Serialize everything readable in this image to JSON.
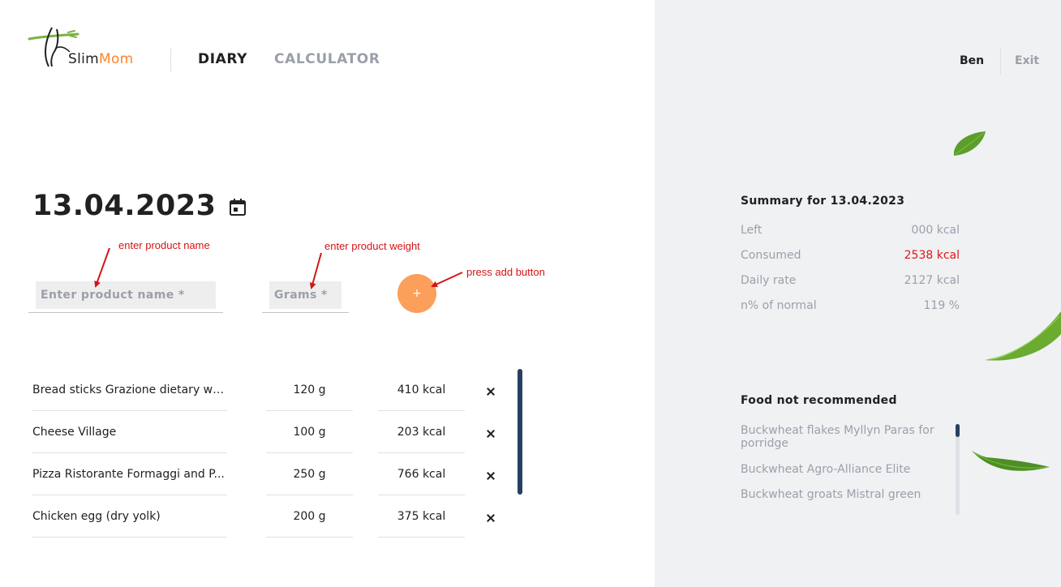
{
  "header": {
    "logo": {
      "slim": "Slim",
      "mom": "Mom"
    },
    "nav": {
      "diary": "DIARY",
      "calculator": "CALCULATOR"
    },
    "user": {
      "name": "Ben",
      "exit": "Exit"
    }
  },
  "diary": {
    "date": "13.04.2023",
    "product_placeholder": "Enter product name *",
    "grams_placeholder": "Grams *",
    "add_label": "+",
    "products": [
      {
        "name": "Bread sticks Grazione dietary wi...",
        "grams": "120 g",
        "kcal": "410 kcal"
      },
      {
        "name": "Cheese Village",
        "grams": "100 g",
        "kcal": "203 kcal"
      },
      {
        "name": "Pizza Ristorante Formaggi and P...",
        "grams": "250 g",
        "kcal": "766 kcal"
      },
      {
        "name": "Chicken egg (dry yolk)",
        "grams": "200 g",
        "kcal": "375 kcal"
      }
    ]
  },
  "annotations": {
    "product": "enter product name",
    "weight": "enter product weight",
    "add": "press add button",
    "color": "#d31515"
  },
  "summary": {
    "title": "Summary for 13.04.2023",
    "rows": [
      {
        "label": "Left",
        "value": "000 kcal"
      },
      {
        "label": "Consumed",
        "value": "2538 kcal",
        "highlight": "#e0151b"
      },
      {
        "label": "Daily rate",
        "value": "2127 kcal"
      },
      {
        "label": "n% of normal",
        "value": "119 %"
      }
    ]
  },
  "not_recommended": {
    "title": "Food not recommended",
    "items": [
      "Buckwheat flakes Myllyn Paras for porridge",
      "Buckwheat Agro-Alliance Elite",
      "Buckwheat groats Mistral green"
    ]
  },
  "colors": {
    "accent": "#fc842d",
    "add_button": "#fc9f5a",
    "scrollbar": "#264061",
    "panel": "#f0f1f3",
    "muted": "#9b9faa"
  }
}
